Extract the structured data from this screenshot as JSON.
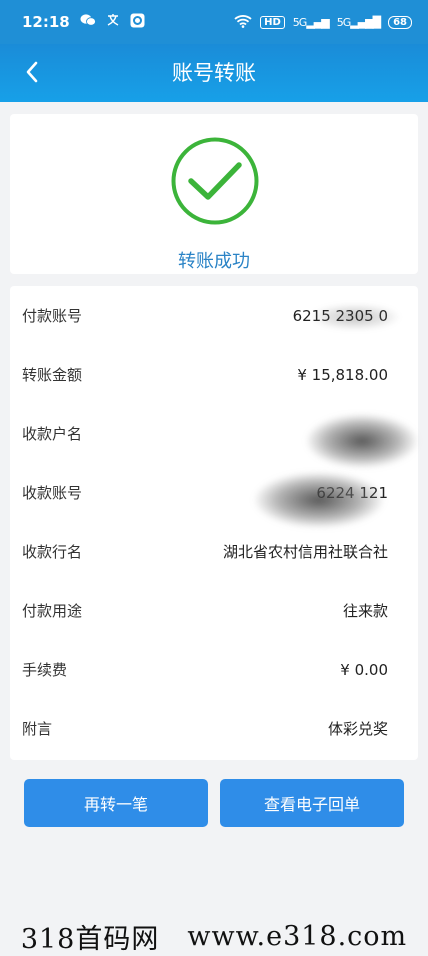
{
  "status_bar": {
    "time": "12:18",
    "hd": "HD",
    "signal1": "5G",
    "signal2": "5G",
    "battery": "68"
  },
  "nav": {
    "title": "账号转账"
  },
  "result": {
    "text": "转账成功"
  },
  "details": [
    {
      "label": "付款账号",
      "value": "6215 2305 0"
    },
    {
      "label": "转账金额",
      "value": "¥ 15,818.00"
    },
    {
      "label": "收款户名",
      "value": ""
    },
    {
      "label": "收款账号",
      "value": "6224 121"
    },
    {
      "label": "收款行名",
      "value": "湖北省农村信用社联合社"
    },
    {
      "label": "付款用途",
      "value": "往来款"
    },
    {
      "label": "手续费",
      "value": "¥ 0.00"
    },
    {
      "label": "附言",
      "value": "体彩兑奖"
    }
  ],
  "buttons": {
    "again": "再转一笔",
    "receipt": "查看电子回单"
  },
  "watermark": {
    "left": "318首码网",
    "right": "www.e318.com"
  },
  "colors": {
    "nav": "#1a8cd8",
    "success_green": "#3cb43a",
    "success_text": "#2a83c6",
    "button": "#2f8de8"
  }
}
